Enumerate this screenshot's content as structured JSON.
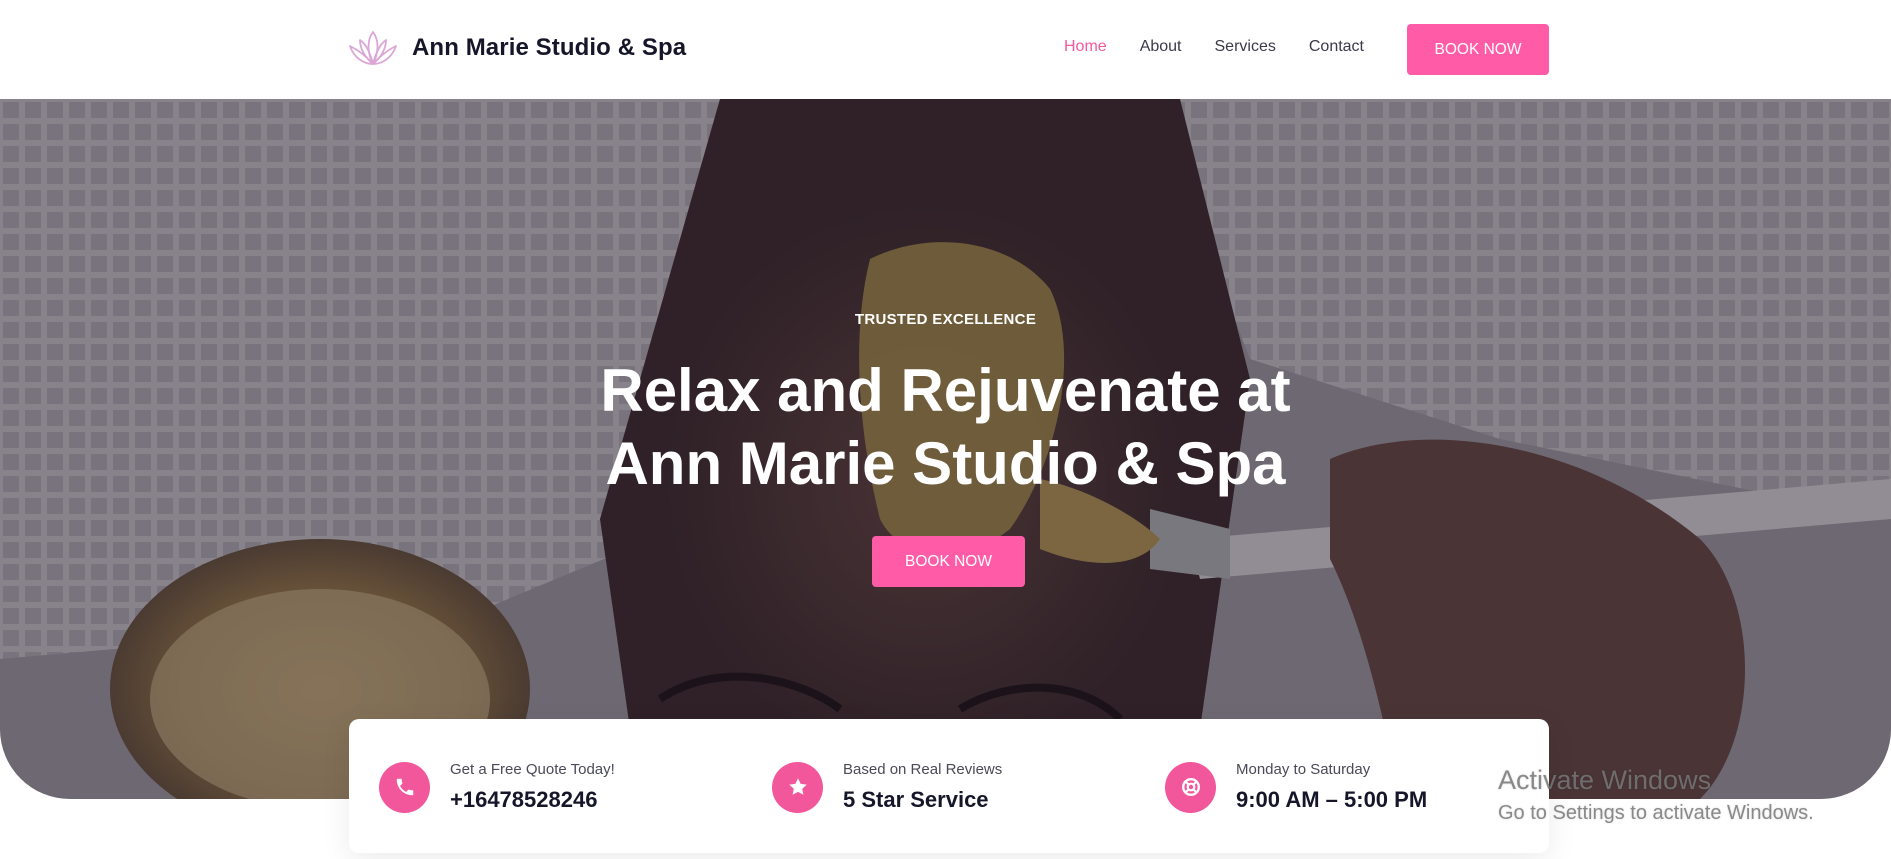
{
  "brand": {
    "name": "Ann Marie Studio & Spa",
    "logo_icon": "lotus-icon",
    "accent": "#ff5ba6"
  },
  "nav": {
    "items": [
      {
        "label": "Home",
        "active": true
      },
      {
        "label": "About",
        "active": false
      },
      {
        "label": "Services",
        "active": false
      },
      {
        "label": "Contact",
        "active": false
      }
    ],
    "cta_label": "BOOK NOW"
  },
  "hero": {
    "kicker": "TRUSTED EXCELLENCE",
    "title_line1": "Relax and Rejuvenate at",
    "title_line2": "Ann Marie Studio & Spa",
    "cta_label": "BOOK NOW"
  },
  "info": [
    {
      "icon": "phone-icon",
      "label": "Get a Free Quote Today!",
      "value": "+16478528246"
    },
    {
      "icon": "star-icon",
      "label": "Based on Real Reviews",
      "value": "5 Star Service"
    },
    {
      "icon": "lifebuoy-icon",
      "label": "Monday to Saturday",
      "value": "9:00 AM – 5:00 PM"
    }
  ],
  "watermark": {
    "title": "Activate Windows",
    "subtitle": "Go to Settings to activate Windows."
  }
}
